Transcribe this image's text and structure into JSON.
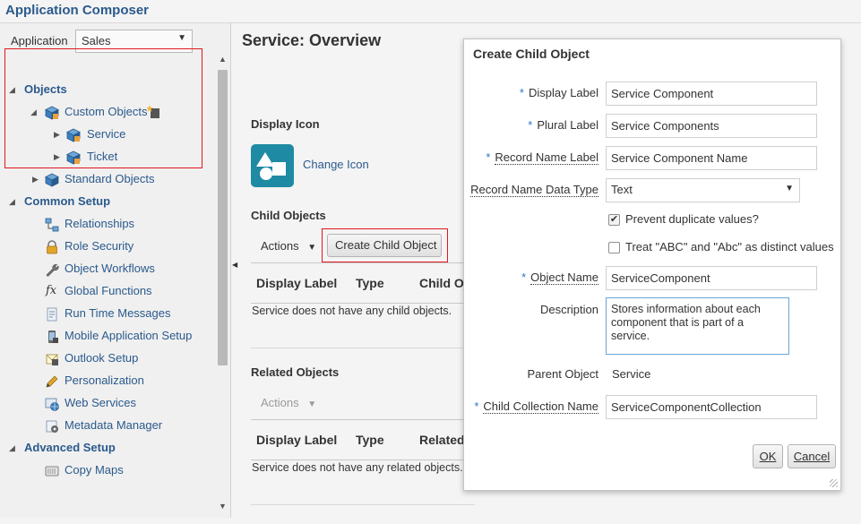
{
  "header": {
    "title": "Application Composer"
  },
  "app_select": {
    "label": "Application",
    "value": "Sales"
  },
  "tree": {
    "objects": "Objects",
    "custom_objects": "Custom Objects",
    "service": "Service",
    "ticket": "Ticket",
    "standard_objects": "Standard Objects",
    "common_setup": "Common Setup",
    "relationships": "Relationships",
    "role_security": "Role Security",
    "object_workflows": "Object Workflows",
    "global_functions": "Global Functions",
    "run_time_messages": "Run Time Messages",
    "mobile_application_setup": "Mobile Application Setup",
    "outlook_setup": "Outlook Setup",
    "personalization": "Personalization",
    "web_services": "Web Services",
    "metadata_manager": "Metadata Manager",
    "advanced_setup": "Advanced Setup",
    "copy_maps": "Copy Maps"
  },
  "main": {
    "title": "Service: Overview",
    "display_icon_label": "Display Icon",
    "change_icon": "Change Icon",
    "child_objects_label": "Child Objects",
    "actions": "Actions",
    "create_child_button": "Create Child Object",
    "col_display_label": "Display Label",
    "col_type": "Type",
    "col_child_object": "Child Ob",
    "child_empty": "Service does not have any child objects.",
    "related_objects_label": "Related Objects",
    "col_related": "Related",
    "related_empty": "Service does not have any related objects."
  },
  "dialog": {
    "title": "Create Child Object",
    "req_marker": "*",
    "display_label_label": "Display Label",
    "display_label_value": "Service Component",
    "plural_label_label": "Plural Label",
    "plural_label_value": "Service Components",
    "record_name_label_label": "Record Name Label",
    "record_name_label_value": "Service Component Name",
    "record_name_type_label": "Record Name Data Type",
    "record_name_type_value": "Text",
    "prevent_duplicates": "Prevent duplicate values?",
    "treat_case": "Treat \"ABC\" and \"Abc\" as distinct values",
    "object_name_label": "Object Name",
    "object_name_value": "ServiceComponent",
    "description_label": "Description",
    "description_value": "Stores information about each component that is part of a service.",
    "parent_object_label": "Parent Object",
    "parent_object_value": "Service",
    "child_collection_label": "Child Collection Name",
    "child_collection_value": "ServiceComponentCollection",
    "ok_button": "OK",
    "cancel_button": "Cancel"
  },
  "colors": {
    "link": "#2a5a8c",
    "highlight_box": "#e2161d",
    "icon_tile": "#1f8aa3",
    "required_marker": "#2a7ac9"
  }
}
